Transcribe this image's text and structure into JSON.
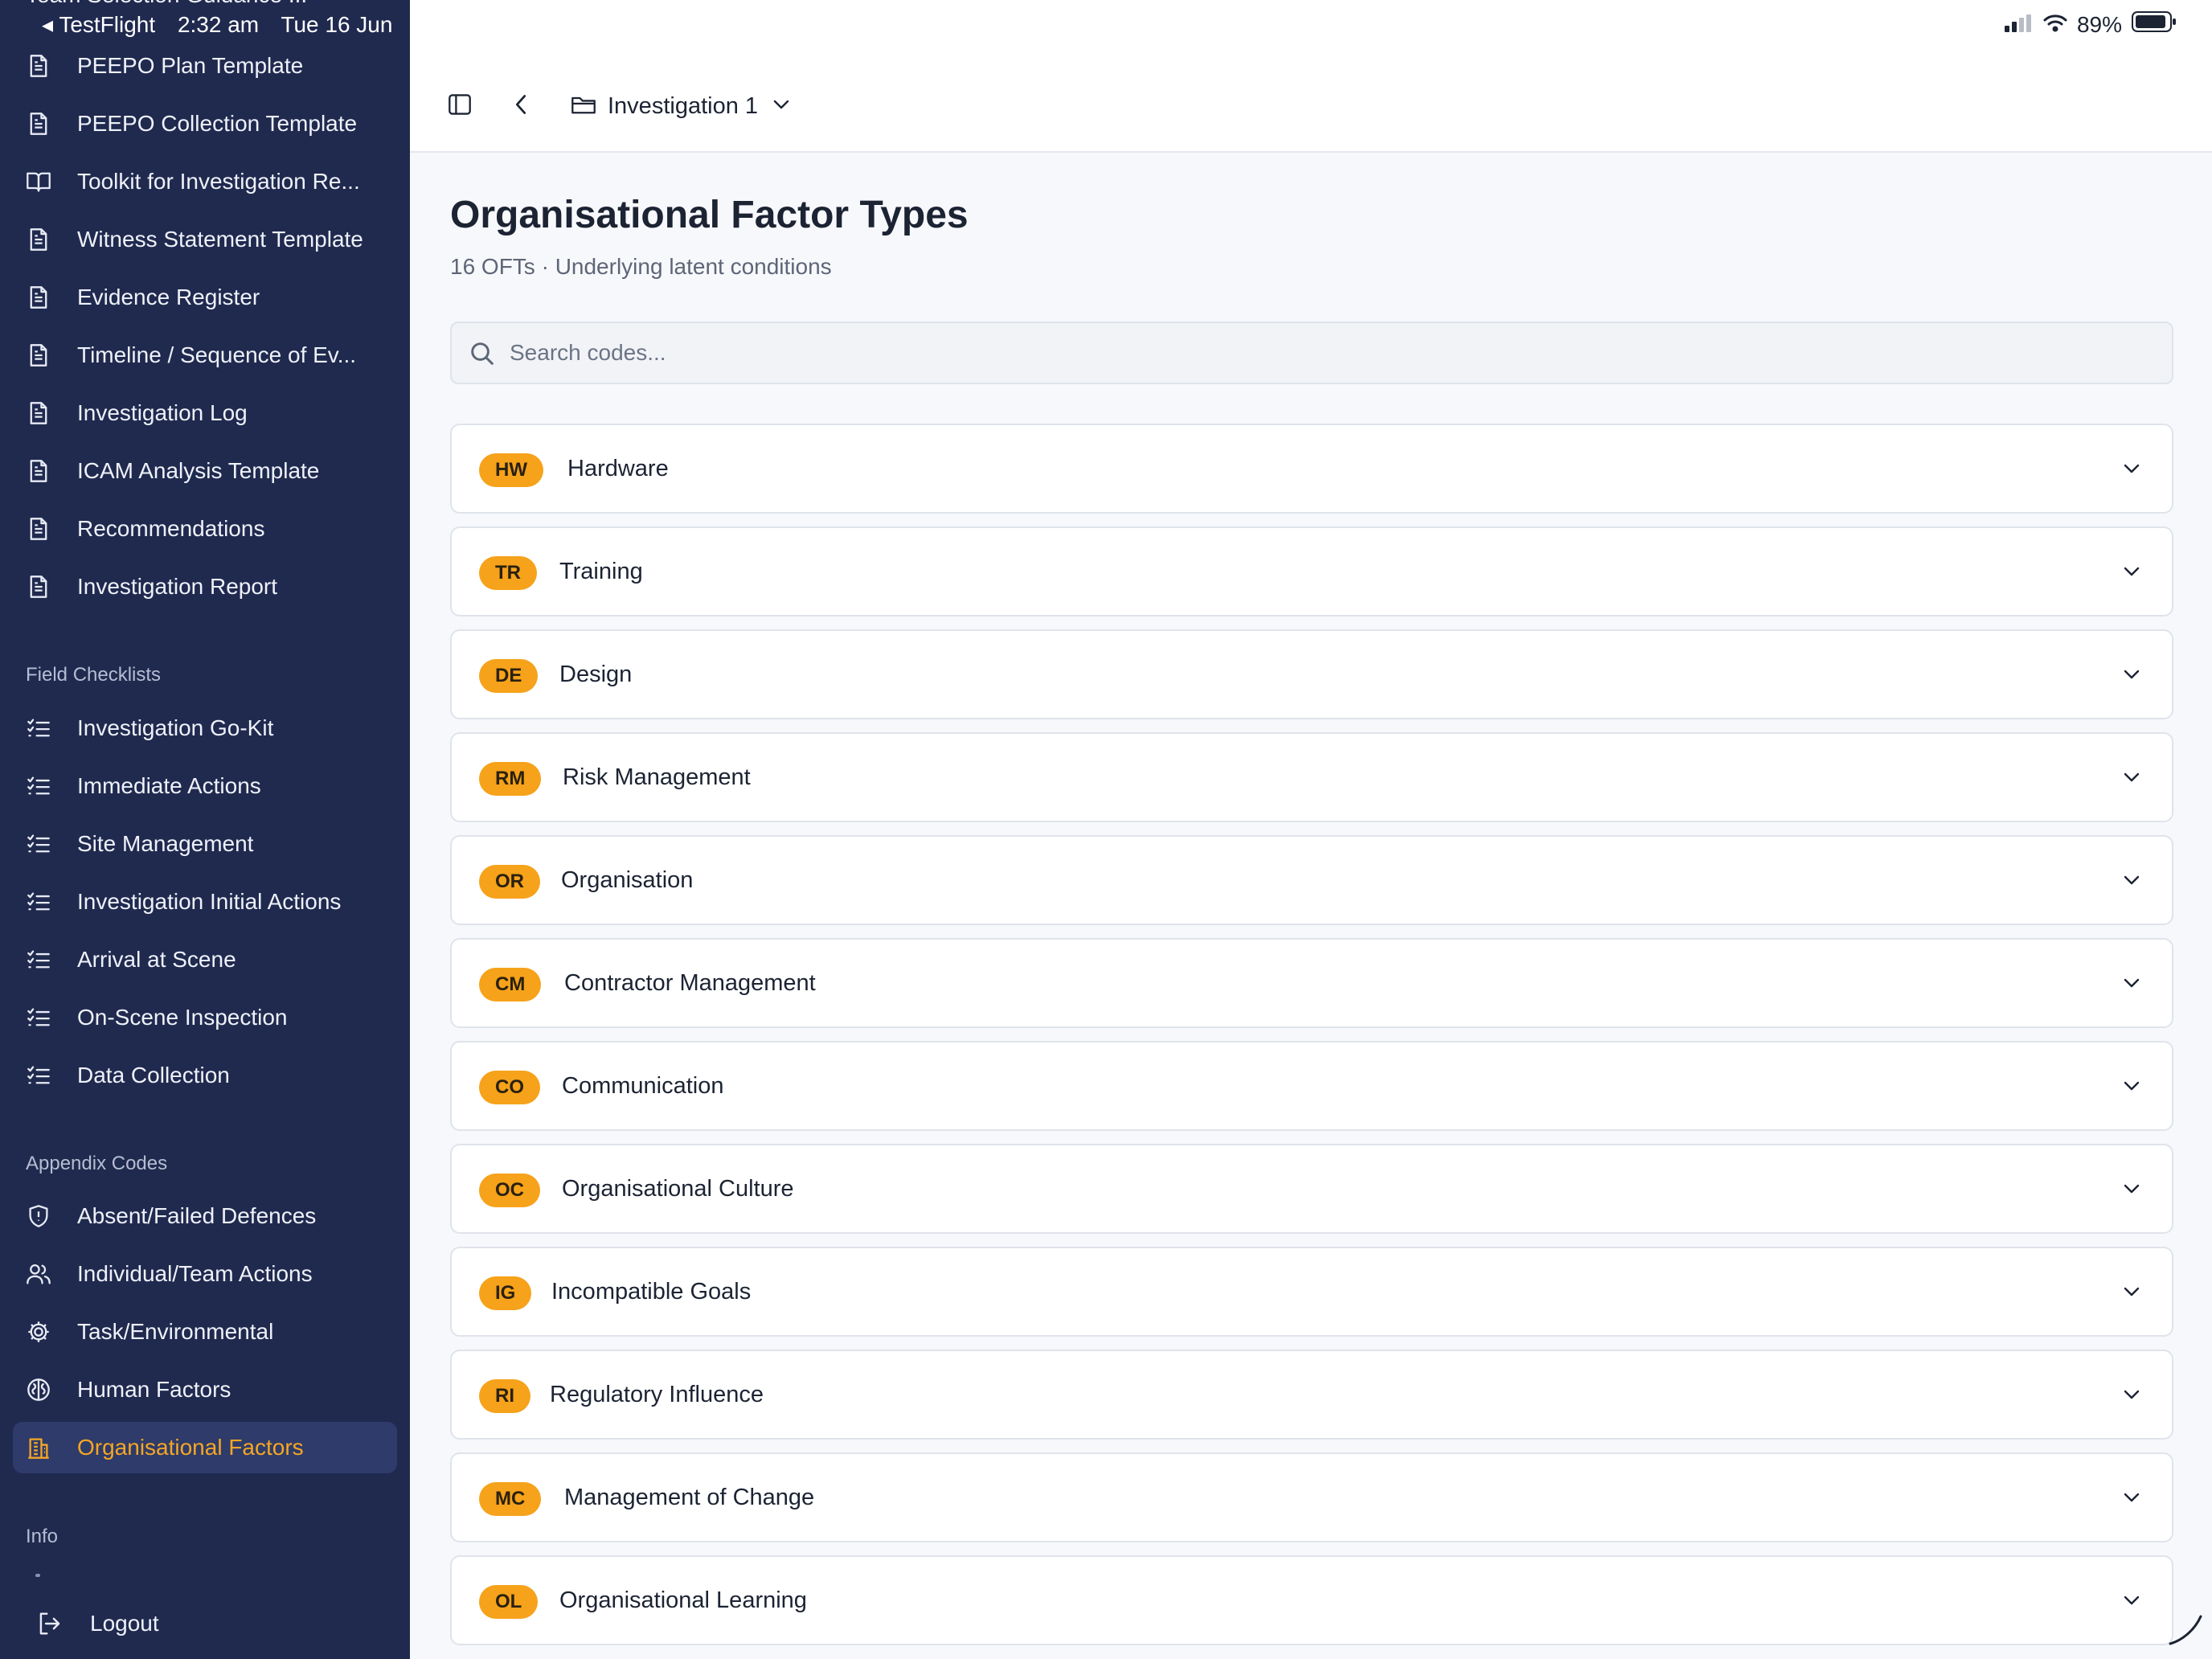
{
  "status_bar": {
    "back_app": "◂ TestFlight",
    "time": "2:32 am",
    "date": "Tue 16 Jun",
    "battery": "89%"
  },
  "sidebar": {
    "cut_item": "Team Selection Guidance ...",
    "documents": [
      {
        "label": "PEEPO Plan Template",
        "icon": "document-icon"
      },
      {
        "label": "PEEPO Collection Template",
        "icon": "document-icon"
      },
      {
        "label": "Toolkit for Investigation Re...",
        "icon": "book-icon"
      },
      {
        "label": "Witness Statement Template",
        "icon": "document-icon"
      },
      {
        "label": "Evidence Register",
        "icon": "document-icon"
      },
      {
        "label": "Timeline / Sequence of Ev...",
        "icon": "document-icon"
      },
      {
        "label": "Investigation Log",
        "icon": "document-icon"
      },
      {
        "label": "ICAM Analysis Template",
        "icon": "document-icon"
      },
      {
        "label": "Recommendations",
        "icon": "document-icon"
      },
      {
        "label": "Investigation Report",
        "icon": "document-icon"
      }
    ],
    "field_checklists_heading": "Field Checklists",
    "checklists": [
      {
        "label": "Investigation Go-Kit",
        "icon": "checklist-icon"
      },
      {
        "label": "Immediate Actions",
        "icon": "checklist-icon"
      },
      {
        "label": "Site Management",
        "icon": "checklist-icon"
      },
      {
        "label": "Investigation Initial Actions",
        "icon": "checklist-icon"
      },
      {
        "label": "Arrival at Scene",
        "icon": "checklist-icon"
      },
      {
        "label": "On-Scene Inspection",
        "icon": "checklist-icon"
      },
      {
        "label": "Data Collection",
        "icon": "checklist-icon"
      }
    ],
    "appendix_heading": "Appendix Codes",
    "appendix": [
      {
        "label": "Absent/Failed Defences",
        "icon": "shield-icon"
      },
      {
        "label": "Individual/Team Actions",
        "icon": "users-icon"
      },
      {
        "label": "Task/Environmental",
        "icon": "gear-icon"
      },
      {
        "label": "Human Factors",
        "icon": "brain-icon"
      },
      {
        "label": "Organisational Factors",
        "icon": "building-icon",
        "active": true
      }
    ],
    "info_heading": "Info",
    "logout_label": "Logout"
  },
  "header": {
    "breadcrumb": "Investigation 1"
  },
  "main": {
    "title": "Organisational Factor Types",
    "subtitle": "16 OFTs · Underlying latent conditions",
    "search_placeholder": "Search codes...",
    "codes": [
      {
        "code": "HW",
        "name": "Hardware"
      },
      {
        "code": "TR",
        "name": "Training"
      },
      {
        "code": "DE",
        "name": "Design"
      },
      {
        "code": "RM",
        "name": "Risk Management"
      },
      {
        "code": "OR",
        "name": "Organisation"
      },
      {
        "code": "CM",
        "name": "Contractor Management"
      },
      {
        "code": "CO",
        "name": "Communication"
      },
      {
        "code": "OC",
        "name": "Organisational Culture"
      },
      {
        "code": "IG",
        "name": "Incompatible Goals"
      },
      {
        "code": "RI",
        "name": "Regulatory Influence"
      },
      {
        "code": "MC",
        "name": "Management of Change"
      },
      {
        "code": "OL",
        "name": "Organisational Learning"
      }
    ]
  },
  "colors": {
    "sidebar_bg": "#202a4f",
    "accent": "#f6a21a",
    "active_bg": "#2e3b6b"
  }
}
